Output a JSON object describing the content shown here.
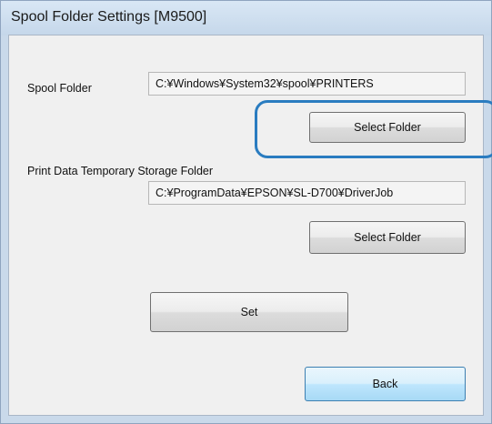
{
  "window": {
    "title": "Spool Folder Settings [M9500]"
  },
  "spool_folder": {
    "label": "Spool Folder",
    "value": "C:¥Windows¥System32¥spool¥PRINTERS",
    "select_button_label": "Select Folder"
  },
  "print_data_folder": {
    "label": "Print Data Temporary Storage Folder",
    "value": "C:¥ProgramData¥EPSON¥SL-D700¥DriverJob",
    "select_button_label": "Select Folder"
  },
  "actions": {
    "set_label": "Set",
    "back_label": "Back"
  },
  "annotation": {
    "highlight_color": "#2a7cc0"
  }
}
